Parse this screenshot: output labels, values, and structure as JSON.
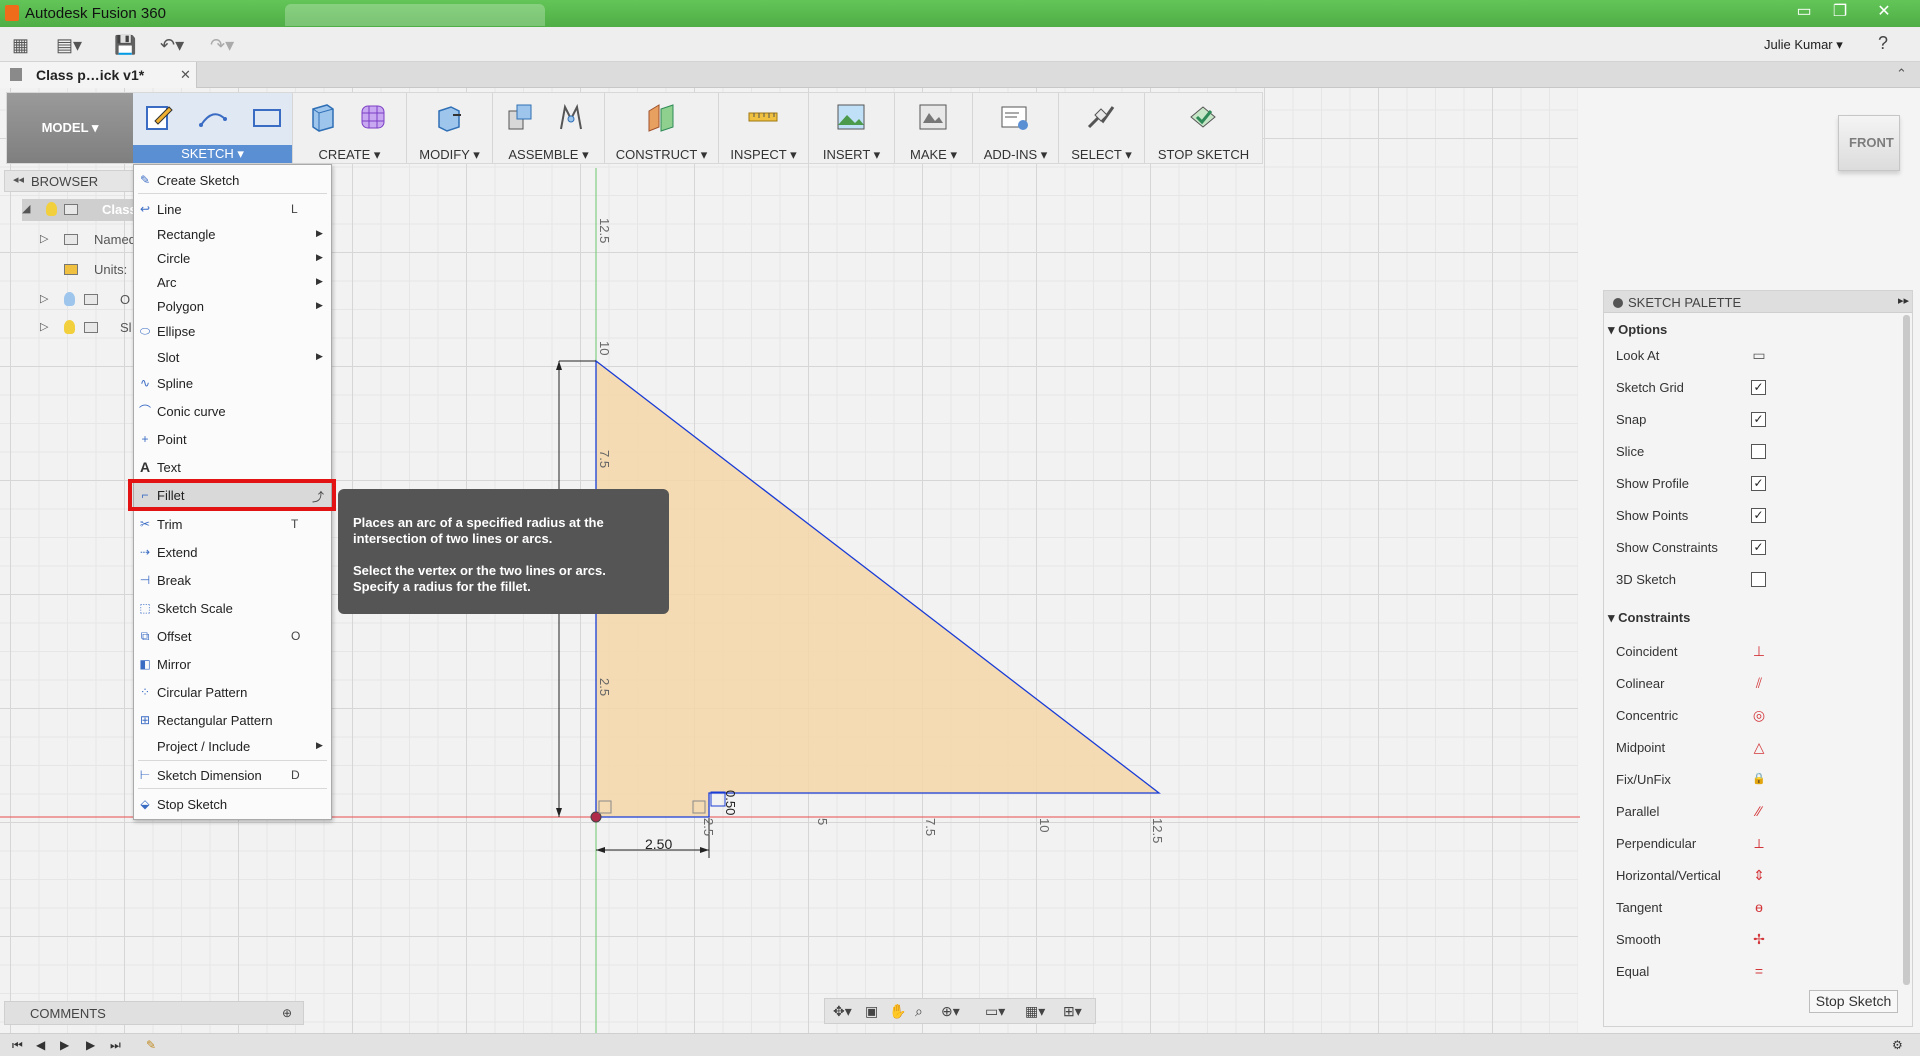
{
  "window": {
    "title": "Autodesk Fusion 360",
    "controls": {
      "minimize": "▭",
      "maximize": "❐",
      "close": "✕"
    }
  },
  "menubar": {
    "user_name": "Julie Kumar ▾",
    "help": "?"
  },
  "doc_tab": {
    "title": "Class p…ick v1*",
    "close": "✕"
  },
  "toolbar": {
    "workspace": "MODEL ▾",
    "groups": [
      {
        "label": "SKETCH ▾"
      },
      {
        "label": "CREATE ▾"
      },
      {
        "label": "MODIFY ▾"
      },
      {
        "label": "ASSEMBLE ▾"
      },
      {
        "label": "CONSTRUCT ▾"
      },
      {
        "label": "INSPECT ▾"
      },
      {
        "label": "INSERT ▾"
      },
      {
        "label": "MAKE ▾"
      },
      {
        "label": "ADD-INS ▾"
      },
      {
        "label": "SELECT ▾"
      },
      {
        "label": "STOP SKETCH"
      }
    ]
  },
  "browser": {
    "header": "BROWSER",
    "items": [
      {
        "label": "Class"
      },
      {
        "label": "Named"
      },
      {
        "label": "Units:"
      },
      {
        "label": "O"
      },
      {
        "label": "Sl"
      }
    ]
  },
  "sketch_menu": {
    "items": [
      {
        "label": "Create Sketch",
        "key": "",
        "icon": "create-sketch-icon"
      },
      {
        "label": "Line",
        "key": "L",
        "icon": "line-icon"
      },
      {
        "label": "Rectangle",
        "key": "",
        "icon": ""
      },
      {
        "label": "Circle",
        "key": "",
        "icon": ""
      },
      {
        "label": "Arc",
        "key": "",
        "icon": ""
      },
      {
        "label": "Polygon",
        "key": "",
        "icon": ""
      },
      {
        "label": "Ellipse",
        "key": "",
        "icon": "ellipse-icon"
      },
      {
        "label": "Slot",
        "key": "",
        "icon": ""
      },
      {
        "label": "Spline",
        "key": "",
        "icon": "spline-icon"
      },
      {
        "label": "Conic curve",
        "key": "",
        "icon": "conic-icon"
      },
      {
        "label": "Point",
        "key": "",
        "icon": "point-icon"
      },
      {
        "label": "Text",
        "key": "",
        "icon": "text-icon"
      },
      {
        "label": "Fillet",
        "key": "",
        "icon": "fillet-icon"
      },
      {
        "label": "Trim",
        "key": "T",
        "icon": "trim-icon"
      },
      {
        "label": "Extend",
        "key": "",
        "icon": "extend-icon"
      },
      {
        "label": "Break",
        "key": "",
        "icon": "break-icon"
      },
      {
        "label": "Sketch Scale",
        "key": "",
        "icon": "sketch-scale-icon"
      },
      {
        "label": "Offset",
        "key": "O",
        "icon": "offset-icon"
      },
      {
        "label": "Mirror",
        "key": "",
        "icon": "mirror-icon"
      },
      {
        "label": "Circular Pattern",
        "key": "",
        "icon": "circular-pattern-icon"
      },
      {
        "label": "Rectangular Pattern",
        "key": "",
        "icon": "rectangular-pattern-icon"
      },
      {
        "label": "Project / Include",
        "key": "",
        "icon": ""
      },
      {
        "label": "Sketch Dimension",
        "key": "D",
        "icon": "sketch-dimension-icon"
      },
      {
        "label": "Stop Sketch",
        "key": "",
        "icon": "stop-sketch-icon"
      }
    ]
  },
  "tooltip": {
    "line1": "Places an arc of a specified radius at the intersection of two lines or arcs.",
    "line2": "Select the vertex or the two lines or arcs. Specify a radius for the fillet."
  },
  "sketch": {
    "vertical_ticks": [
      "12.5",
      "10",
      "7.5",
      "2.5"
    ],
    "horizontal_ticks": [
      "2.5",
      "5",
      "7.5",
      "10",
      "12.5"
    ],
    "dim_width": "2.50",
    "dim_height": "0.50"
  },
  "palette": {
    "title": "SKETCH PALETTE",
    "options_title": "Options",
    "options": [
      {
        "label": "Look At",
        "type": "icon"
      },
      {
        "label": "Sketch Grid",
        "checked": true
      },
      {
        "label": "Snap",
        "checked": true
      },
      {
        "label": "Slice",
        "checked": false
      },
      {
        "label": "Show Profile",
        "checked": true
      },
      {
        "label": "Show Points",
        "checked": true
      },
      {
        "label": "Show Constraints",
        "checked": true
      },
      {
        "label": "3D Sketch",
        "checked": false
      }
    ],
    "constraints_title": "Constraints",
    "constraints": [
      {
        "label": "Coincident",
        "glyph": "⊥"
      },
      {
        "label": "Colinear",
        "glyph": "⫽"
      },
      {
        "label": "Concentric",
        "glyph": "◎"
      },
      {
        "label": "Midpoint",
        "glyph": "△"
      },
      {
        "label": "Fix/UnFix",
        "glyph": "🔒"
      },
      {
        "label": "Parallel",
        "glyph": "∕∕"
      },
      {
        "label": "Perpendicular",
        "glyph": "⟂"
      },
      {
        "label": "Horizontal/Vertical",
        "glyph": "⇕"
      },
      {
        "label": "Tangent",
        "glyph": "ɵ"
      },
      {
        "label": "Smooth",
        "glyph": "✢"
      },
      {
        "label": "Equal",
        "glyph": "="
      }
    ],
    "stop_button": "Stop Sketch"
  },
  "viewcube": {
    "face": "FRONT"
  },
  "comments": {
    "label": "COMMENTS"
  },
  "colors": {
    "titlebar": "#4fae46",
    "sketch_blue": "#1a3cd6",
    "profile_fill": "#f5d7a8",
    "highlight_red": "#e31313",
    "x_axis": "#e84a4a",
    "y_axis": "#6cc86c"
  }
}
